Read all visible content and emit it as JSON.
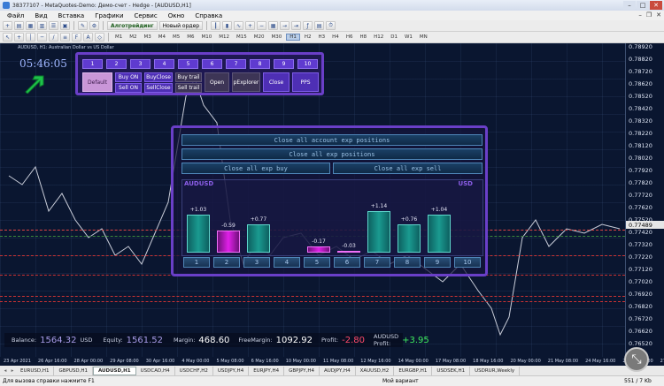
{
  "window": {
    "title": "38377107 - MetaQuotes-Demo: Демо-счет - Hedge - [AUDUSD,H1]"
  },
  "menu": [
    "Файл",
    "Вид",
    "Вставка",
    "Графики",
    "Сервис",
    "Окно",
    "Справка"
  ],
  "toolbar": {
    "algo_label": "Алготрейдинг",
    "new_order_label": "Новый ордер",
    "timeframes": [
      "M1",
      "M2",
      "M3",
      "M4",
      "M5",
      "M6",
      "M10",
      "M12",
      "M15",
      "M20",
      "M30",
      "H1",
      "H2",
      "H3",
      "H4",
      "H6",
      "H8",
      "H12",
      "D1",
      "W1",
      "MN"
    ],
    "active_timeframe": "H1"
  },
  "chart": {
    "title": "AUDUSD, H1: Australian Dollar vs US Dollar",
    "clock": "05:46:05",
    "price_labels": [
      "0.78920",
      "0.78820",
      "0.78720",
      "0.78620",
      "0.78520",
      "0.78420",
      "0.78320",
      "0.78220",
      "0.78120",
      "0.78020",
      "0.77920",
      "0.77820",
      "0.77720",
      "0.77620",
      "0.77520",
      "0.77420",
      "0.77320",
      "0.77220",
      "0.77120",
      "0.77020",
      "0.76920",
      "0.76820",
      "0.76720",
      "0.76620",
      "0.76520"
    ],
    "current_price": "0.77489",
    "time_labels": [
      "23 Apr 2021",
      "26 Apr 16:00",
      "28 Apr 00:00",
      "29 Apr 08:00",
      "30 Apr 16:00",
      "4 May 00:00",
      "5 May 08:00",
      "6 May 16:00",
      "10 May 00:00",
      "11 May 08:00",
      "12 May 16:00",
      "14 May 00:00",
      "17 May 08:00",
      "18 May 16:00",
      "20 May 00:00",
      "21 May 08:00",
      "24 May 16:00",
      "26 May 00:00",
      "27 May 08:00",
      "28 May 16:00",
      "1 Jun 00:00",
      "2 Jun 08:00",
      "3 Jun 16:00",
      "7 Jun 00:00",
      "8 Jun 08:00",
      "9 Jun 16:00",
      "11 Jun 00:00"
    ]
  },
  "panel_top": {
    "numbers": [
      "1",
      "2",
      "3",
      "4",
      "5",
      "6",
      "7",
      "8",
      "9",
      "10"
    ],
    "default_label": "Default",
    "buy_on": "Buy ON",
    "sell_on": "Sell ON",
    "buy_close": "BuyClose",
    "sell_close": "SellClose",
    "buy_trail": "Buy trail",
    "sell_trail": "Sell trail",
    "open": "Open",
    "pexplorer": "pExplorer",
    "close": "Close",
    "pps": "PPS"
  },
  "panel_big": {
    "close_all_account": "Close all account exp positions",
    "close_all": "Close all exp positions",
    "close_buy": "Close all exp buy",
    "close_sell": "Close all exp sell",
    "left_currency": "AUDUSD",
    "right_currency": "USD",
    "indices": [
      "1",
      "2",
      "3",
      "4",
      "5",
      "6",
      "7",
      "8",
      "9",
      "10"
    ]
  },
  "chart_data": {
    "type": "bar",
    "categories": [
      "1",
      "2",
      "3",
      "4",
      "5",
      "6",
      "7",
      "8",
      "9",
      "10"
    ],
    "values": [
      1.03,
      -0.59,
      0.77,
      null,
      -0.17,
      -0.03,
      1.14,
      0.76,
      1.04,
      null
    ],
    "labels": [
      "+1.03",
      "-0.59",
      "+0.77",
      "",
      "-0.17",
      "-0.03",
      "+1.14",
      "+0.76",
      "+1.04",
      ""
    ],
    "xlabel": "",
    "ylabel": "",
    "colors": {
      "positive": "#1a9a90",
      "negative": "#e020e8"
    }
  },
  "info": {
    "balance_label": "Balance:",
    "balance": "1564.32",
    "balance_cur": "USD",
    "equity_label": "Equity:",
    "equity": "1561.52",
    "margin_label": "Margin:",
    "margin": "468.60",
    "free_margin_label": "FreeMargin:",
    "free_margin": "1092.92",
    "profit_label": "Profit:",
    "profit": "-2.80",
    "symbol_profit_label": "AUDUSD Profit:",
    "symbol_profit": "+3.95"
  },
  "tabs": [
    "EURUSD,H1",
    "GBPUSD,H1",
    "AUDUSD,H1",
    "USDCAD,H4",
    "USDCHF,H2",
    "USDJPY,H4",
    "EURJPY,H4",
    "GBPJPY,H4",
    "AUDJPY,H4",
    "XAUUSD,H2",
    "EURGBP,H1",
    "USDSEK,H1",
    "USDRUR,Weekly"
  ],
  "active_tab": "AUDUSD,H1",
  "status": {
    "help": "Для вызова справки нажмите F1",
    "profile": "Мой вариант",
    "traffic": "551 / 7 Kb"
  }
}
